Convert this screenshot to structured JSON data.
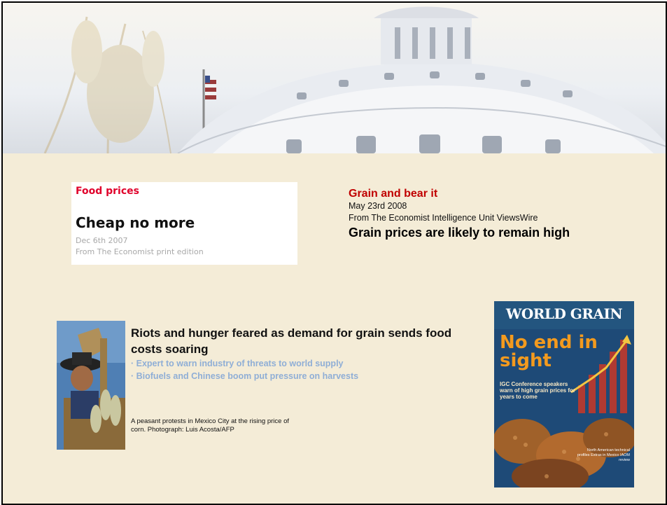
{
  "economist_clip": {
    "kicker": "Food prices",
    "headline": "Cheap no more",
    "date": "Dec 6th 2007",
    "source": "From The Economist print edition"
  },
  "eiu_article": {
    "title": "Grain and bear it",
    "date": "May 23rd 2008",
    "source": "From The Economist Intelligence Unit ViewsWire",
    "subhead": "Grain prices are likely to remain high"
  },
  "guardian_article": {
    "headline": "Riots and hunger feared as demand for grain sends food costs soaring",
    "bullets": [
      "· Expert to warn industry of threats to world supply",
      "· Biofuels and Chinese boom put pressure on harvests"
    ],
    "caption": "A peasant protests in Mexico City at the rising price of corn. Photograph: Luis Acosta/AFP"
  },
  "world_grain_cover": {
    "masthead": "WORLD GRAIN",
    "headline": "No end in sight",
    "subhead": "IGC Conference speakers warn of high grain prices for years to come",
    "bottom_note": "North American technical profiles Extras in Mexico IAOM review"
  },
  "colors": {
    "slide_background": "#f4ecd7",
    "eiu_title": "#c00000",
    "economist_kicker": "#e0002a",
    "guardian_bullet": "#8faed6",
    "cover_background": "#1f4e7a",
    "cover_headline": "#f39a1e"
  }
}
